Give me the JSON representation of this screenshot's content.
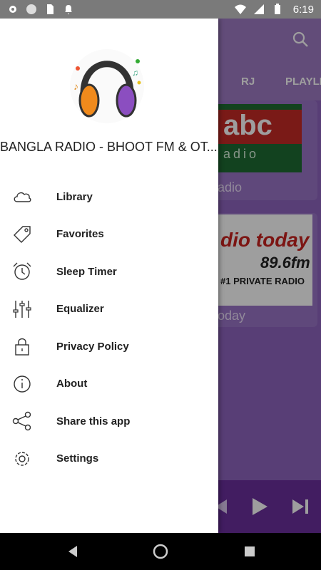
{
  "status_bar": {
    "time": "6:19",
    "icons": [
      "gear-icon",
      "circle-icon",
      "sd-card-icon",
      "bell-icon",
      "wifi-icon",
      "signal-icon",
      "battery-icon"
    ]
  },
  "app": {
    "tabs": [
      {
        "label": "RJ"
      },
      {
        "label": "PLAYLI"
      }
    ],
    "cards": [
      {
        "logo_main": "abc",
        "logo_sub": "adio",
        "label": "adio"
      },
      {
        "logo_main": "dio today",
        "logo_freq": "89.6fm",
        "logo_sub": "#1 PRIVATE RADIO",
        "label": "oday"
      }
    ]
  },
  "drawer": {
    "title": "BANGLA RADIO - BHOOT FM & OT...",
    "menu": [
      {
        "label": "Library",
        "icon": "cloud-icon"
      },
      {
        "label": "Favorites",
        "icon": "tag-icon"
      },
      {
        "label": "Sleep Timer",
        "icon": "alarm-clock-icon"
      },
      {
        "label": "Equalizer",
        "icon": "equalizer-icon"
      },
      {
        "label": "Privacy Policy",
        "icon": "lock-icon"
      },
      {
        "label": "About",
        "icon": "info-icon"
      },
      {
        "label": "Share this app",
        "icon": "share-icon"
      },
      {
        "label": "Settings",
        "icon": "gear-icon"
      }
    ]
  },
  "colors": {
    "accent": "#7a3fb0",
    "drawer_bg": "#ffffff",
    "status_bar": "#7a7a7a"
  }
}
